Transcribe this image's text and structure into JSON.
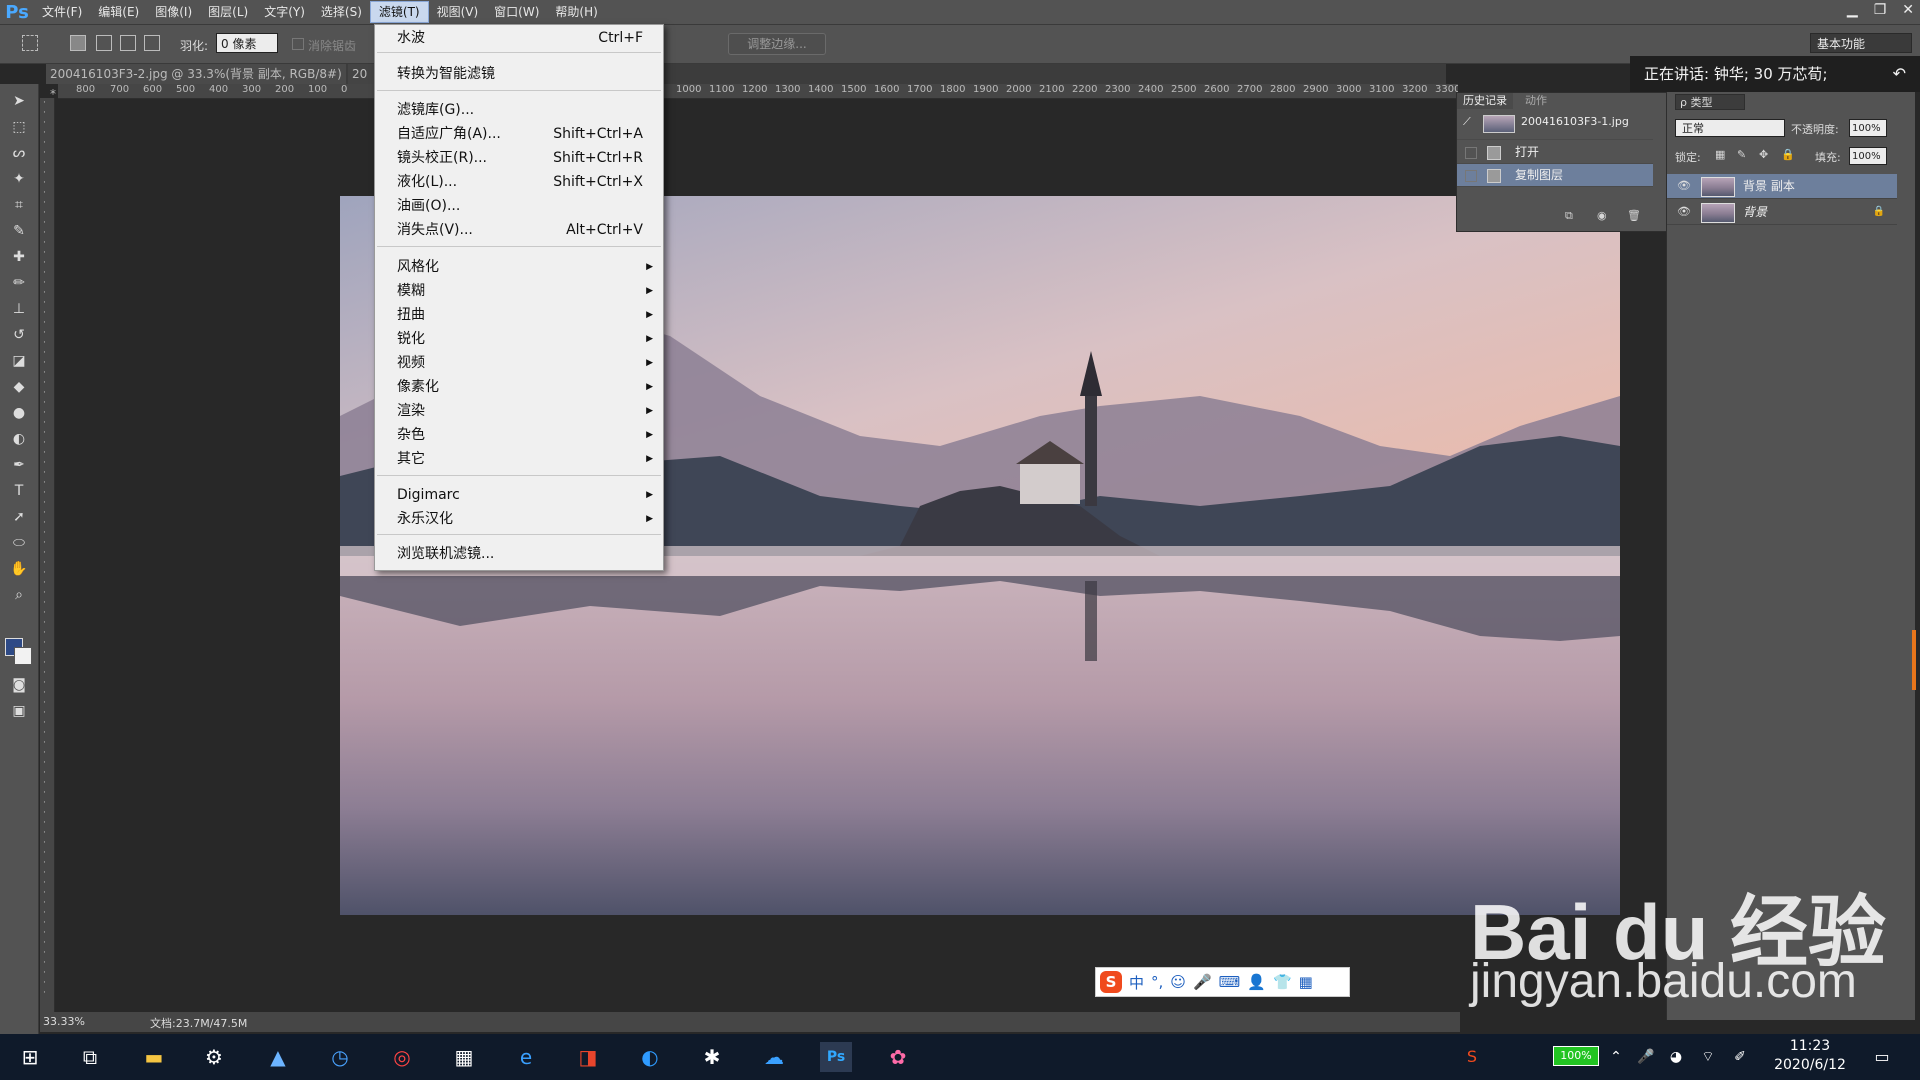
{
  "menubar": {
    "logo": "Ps",
    "items": [
      "文件(F)",
      "编辑(E)",
      "图像(I)",
      "图层(L)",
      "文字(Y)",
      "选择(S)",
      "滤镜(T)",
      "视图(V)",
      "窗口(W)",
      "帮助(H)"
    ],
    "active_index": 6
  },
  "window_controls": [
    "▁",
    "❐",
    "✕"
  ],
  "options_bar": {
    "feather_label": "羽化:",
    "feather_value": "0 像素",
    "antialias_label": "消除锯齿",
    "refine_edge_button": "调整边缘...",
    "workspace": "基本功能"
  },
  "document_tab": {
    "title": "200416103F3-2.jpg @ 33.3%(背景 副本, RGB/8#) * ×",
    "second_tab": "20"
  },
  "rulers": {
    "top_ticks_left": [
      "800",
      "700",
      "600",
      "500",
      "400",
      "300",
      "200",
      "100",
      "0"
    ],
    "top_ticks_right": [
      "1000",
      "1100",
      "1200",
      "1300",
      "1400",
      "1500",
      "1600",
      "1700",
      "1800",
      "1900",
      "2000",
      "2100",
      "2200",
      "2300",
      "2400",
      "2500",
      "2600",
      "2700",
      "2800",
      "2900",
      "3000",
      "3100",
      "3200",
      "3300"
    ]
  },
  "filter_menu": {
    "groups": [
      [
        {
          "label": "水波",
          "shortcut": "Ctrl+F"
        }
      ],
      [
        {
          "label": "转换为智能滤镜",
          "shortcut": ""
        }
      ],
      [
        {
          "label": "滤镜库(G)...",
          "shortcut": ""
        },
        {
          "label": "自适应广角(A)...",
          "shortcut": "Shift+Ctrl+A"
        },
        {
          "label": "镜头校正(R)...",
          "shortcut": "Shift+Ctrl+R"
        },
        {
          "label": "液化(L)...",
          "shortcut": "Shift+Ctrl+X"
        },
        {
          "label": "油画(O)...",
          "shortcut": ""
        },
        {
          "label": "消失点(V)...",
          "shortcut": "Alt+Ctrl+V"
        }
      ],
      [
        {
          "label": "风格化",
          "submenu": true
        },
        {
          "label": "模糊",
          "submenu": true
        },
        {
          "label": "扭曲",
          "submenu": true
        },
        {
          "label": "锐化",
          "submenu": true
        },
        {
          "label": "视频",
          "submenu": true
        },
        {
          "label": "像素化",
          "submenu": true
        },
        {
          "label": "渲染",
          "submenu": true
        },
        {
          "label": "杂色",
          "submenu": true
        },
        {
          "label": "其它",
          "submenu": true
        }
      ],
      [
        {
          "label": "Digimarc",
          "submenu": true
        },
        {
          "label": "永乐汉化",
          "submenu": true
        }
      ],
      [
        {
          "label": "浏览联机滤镜...",
          "shortcut": ""
        }
      ]
    ]
  },
  "history_panel": {
    "tabs": [
      "历史记录",
      "动作"
    ],
    "snapshot": "200416103F3-1.jpg",
    "steps": [
      "打开",
      "复制图层"
    ],
    "selected_step": 1
  },
  "layers_panel": {
    "filter_label": "ρ 类型",
    "blend_mode": "正常",
    "opacity_label": "不透明度:",
    "opacity_value": "100%",
    "lock_label": "锁定:",
    "fill_label": "填充:",
    "fill_value": "100%",
    "layers": [
      {
        "name": "背景 副本",
        "visible": true,
        "selected": true,
        "locked": false
      },
      {
        "name": "背景",
        "visible": true,
        "selected": false,
        "locked": true
      }
    ]
  },
  "status_bar": {
    "zoom": "33.33%",
    "doc_size": "文档:23.7M/47.5M"
  },
  "toast": {
    "text": "正在讲话: 钟华; 30 万芯荀;"
  },
  "ime_bar": {
    "items": [
      "S",
      "中",
      "°,",
      "☺",
      "🎤",
      "⌨",
      "👤",
      "👕",
      "▦"
    ]
  },
  "watermark": {
    "brand": "Bai du 经验",
    "url": "jingyan.baidu.com"
  },
  "taskbar": {
    "battery": "100%",
    "time": "11:23",
    "date": "2020/6/12"
  },
  "colors": {
    "accent_selection": "#6d7f9c",
    "scroll_orange": "#e8761c",
    "foreground_color": "#2e4a86"
  }
}
